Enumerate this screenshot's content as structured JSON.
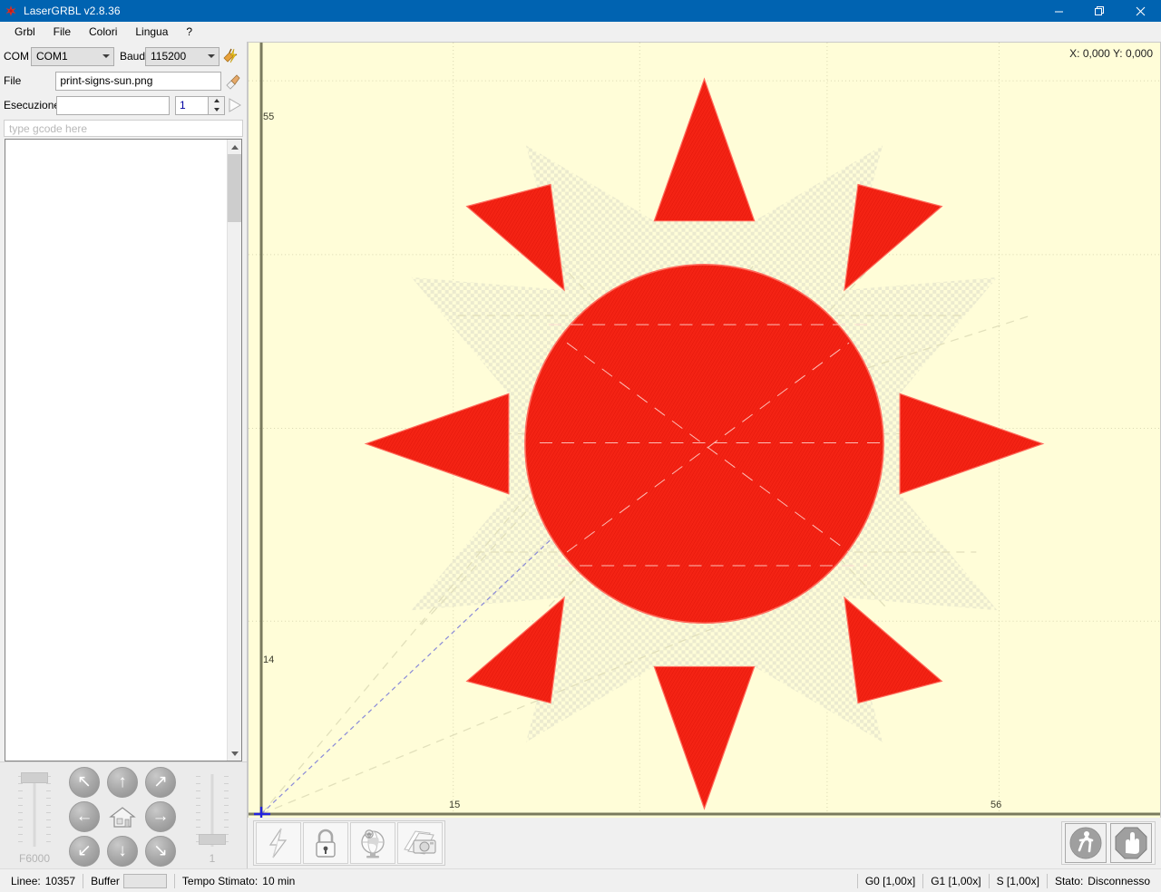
{
  "window": {
    "title": "LaserGRBL v2.8.36",
    "icon": "lasergrbl-logo-icon",
    "minimize_label": "—",
    "restore_label": "❐",
    "close_label": "✕"
  },
  "menubar": {
    "items": [
      {
        "label": "Grbl",
        "name": "menu-grbl"
      },
      {
        "label": "File",
        "name": "menu-file"
      },
      {
        "label": "Colori",
        "name": "menu-colori"
      },
      {
        "label": "Lingua",
        "name": "menu-lingua"
      },
      {
        "label": "?",
        "name": "menu-help"
      }
    ]
  },
  "connection": {
    "com_label": "COM",
    "com_value": "COM1",
    "baud_label": "Baud",
    "baud_value": "115200",
    "connect_icon": "connect-plug-icon",
    "file_label": "File",
    "file_value": "print-signs-sun.png",
    "file_icon": "eraser-pencil-icon",
    "exec_label": "Esecuzione",
    "exec_value": "",
    "repeat_value": "1",
    "run_icon": "play-icon"
  },
  "gcode": {
    "input_placeholder": "type gcode here",
    "input_value": "",
    "lines": []
  },
  "jog": {
    "feed_label": "F6000",
    "step_label": "1",
    "buttons": [
      {
        "name": "jog-up-left",
        "glyph": "↖"
      },
      {
        "name": "jog-up",
        "glyph": "↑"
      },
      {
        "name": "jog-up-right",
        "glyph": "↗"
      },
      {
        "name": "jog-left",
        "glyph": "←"
      },
      {
        "name": "jog-home",
        "glyph": "⌂"
      },
      {
        "name": "jog-right",
        "glyph": "→"
      },
      {
        "name": "jog-down-left",
        "glyph": "↙"
      },
      {
        "name": "jog-down",
        "glyph": "↓"
      },
      {
        "name": "jog-down-right",
        "glyph": "↘"
      }
    ]
  },
  "viewer": {
    "coordinates": "X: 0,000 Y: 0,000",
    "background_color": "#fffdd8",
    "engrave_color": "#f42314",
    "axis_color": "#7a7a5e",
    "origin_marker_color": "#2222dd",
    "axis_labels": {
      "y_top": "55",
      "y_bottom": "14",
      "x_left": "15",
      "x_right": "56"
    }
  },
  "toolbar": {
    "left_buttons": [
      {
        "name": "unlock-bolt-button",
        "icon": "lightning-bolt-icon"
      },
      {
        "name": "lock-button",
        "icon": "padlock-icon"
      },
      {
        "name": "set-origin-button",
        "icon": "globe-pin-icon"
      },
      {
        "name": "image-import-button",
        "icon": "photo-camera-icon"
      }
    ],
    "right_buttons": [
      {
        "name": "run-program-button",
        "icon": "walking-person-icon"
      },
      {
        "name": "stop-program-button",
        "icon": "stop-hand-icon"
      }
    ]
  },
  "statusbar": {
    "lines_label": "Linee:",
    "lines_value": "10357",
    "buffer_label": "Buffer",
    "time_label": "Tempo Stimato:",
    "time_value": "10 min",
    "g0_label": "G0 [1,00x]",
    "g1_label": "G1 [1,00x]",
    "s_label": "S [1,00x]",
    "state_label": "Stato:",
    "state_value": "Disconnesso"
  }
}
